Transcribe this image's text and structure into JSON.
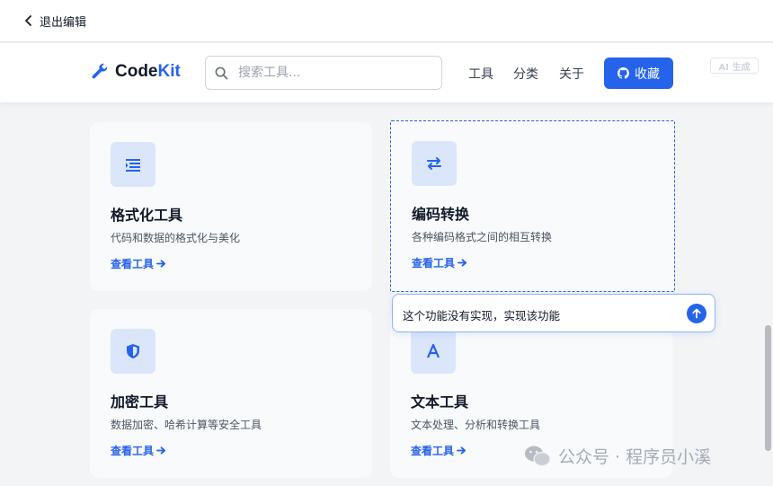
{
  "topbar": {
    "exit_label": "退出编辑"
  },
  "navbar": {
    "brand_prefix": "Code",
    "brand_accent": "Kit",
    "search_placeholder": "搜索工具...",
    "links": [
      "工具",
      "分类",
      "关于"
    ],
    "favorite_label": "收藏",
    "ai_badge": "AI 生成"
  },
  "cards": [
    {
      "title": "格式化工具",
      "desc": "代码和数据的格式化与美化",
      "link": "查看工具",
      "icon": "align-left-icon"
    },
    {
      "title": "编码转换",
      "desc": "各种编码格式之间的相互转换",
      "link": "查看工具",
      "icon": "exchange-icon"
    },
    {
      "title": "加密工具",
      "desc": "数据加密、哈希计算等安全工具",
      "link": "查看工具",
      "icon": "shield-icon"
    },
    {
      "title": "文本工具",
      "desc": "文本处理、分析和转换工具",
      "link": "查看工具",
      "icon": "font-icon"
    }
  ],
  "prompt": {
    "text": "这个功能没有实现，实现该功能"
  },
  "watermark": {
    "text": "公众号 · 程序员小溪"
  },
  "colors": {
    "accent": "#2563eb",
    "icon_bg": "#dbe6fb",
    "card_bg": "#f9fafb",
    "page_bg": "#f3f4f6"
  }
}
